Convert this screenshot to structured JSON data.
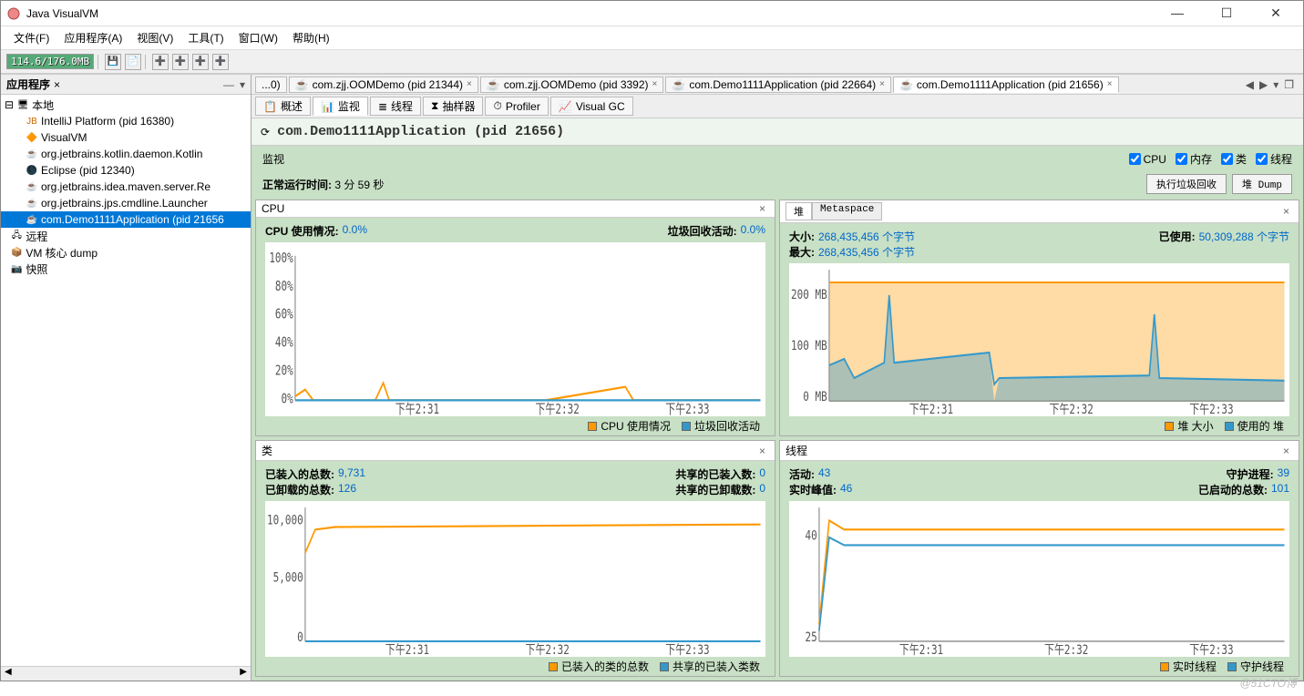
{
  "window": {
    "title": "Java VisualVM"
  },
  "menus": [
    "文件(F)",
    "应用程序(A)",
    "视图(V)",
    "工具(T)",
    "窗口(W)",
    "帮助(H)"
  ],
  "toolbar": {
    "mem": "114.6/176.0MB"
  },
  "sidebar": {
    "title": "应用程序",
    "nodes": {
      "local": "本地",
      "items": [
        "IntelliJ Platform (pid 16380)",
        "VisualVM",
        "org.jetbrains.kotlin.daemon.Kotlin",
        "Eclipse (pid 12340)",
        "org.jetbrains.idea.maven.server.Re",
        "org.jetbrains.jps.cmdline.Launcher",
        "com.Demo1111Application (pid 21656"
      ],
      "remote": "远程",
      "vmdump": "VM 核心 dump",
      "snapshot": "快照"
    }
  },
  "tabs": [
    "...0)",
    "com.zjj.OOMDemo (pid 21344)",
    "com.zjj.OOMDemo (pid 3392)",
    "com.Demo1111Application (pid 22664)",
    "com.Demo1111Application (pid 21656)"
  ],
  "subtabs": [
    "概述",
    "监视",
    "线程",
    "抽样器",
    "Profiler",
    "Visual GC"
  ],
  "app": {
    "name": "com.Demo1111Application (pid 21656)"
  },
  "monitor": {
    "label": "监视",
    "checks": [
      "CPU",
      "内存",
      "类",
      "线程"
    ],
    "buttons": {
      "gc": "执行垃圾回收",
      "dump": "堆 Dump"
    },
    "uptime_label": "正常运行时间:",
    "uptime_value": "3 分 59 秒"
  },
  "cpu": {
    "title": "CPU",
    "usage_label": "CPU 使用情况:",
    "usage_value": "0.0%",
    "gc_label": "垃圾回收活动:",
    "gc_value": "0.0%",
    "legend": [
      "CPU 使用情况",
      "垃圾回收活动"
    ],
    "xticks": [
      "下午2:31",
      "下午2:32",
      "下午2:33"
    ],
    "ylabels": [
      "0%",
      "20%",
      "40%",
      "60%",
      "80%",
      "100%"
    ]
  },
  "heap": {
    "tabs": [
      "堆",
      "Metaspace"
    ],
    "size_label": "大小:",
    "size_value": "268,435,456 个字节",
    "max_label": "最大:",
    "max_value": "268,435,456 个字节",
    "used_label": "已使用:",
    "used_value": "50,309,288 个字节",
    "legend": [
      "堆 大小",
      "使用的 堆"
    ],
    "xticks": [
      "下午2:31",
      "下午2:32",
      "下午2:33"
    ],
    "ylabels": [
      "0 MB",
      "100 MB",
      "200 MB"
    ]
  },
  "classes": {
    "title": "类",
    "loaded_label": "已装入的总数:",
    "loaded_value": "9,731",
    "unloaded_label": "已卸载的总数:",
    "unloaded_value": "126",
    "shared_loaded_label": "共享的已装入数:",
    "shared_loaded_value": "0",
    "shared_unloaded_label": "共享的已卸载数:",
    "shared_unloaded_value": "0",
    "legend": [
      "已装入的类的总数",
      "共享的已装入类数"
    ],
    "xticks": [
      "下午2:31",
      "下午2:32",
      "下午2:33"
    ],
    "ylabels": [
      "0",
      "5,000",
      "10,000"
    ]
  },
  "threads": {
    "title": "线程",
    "live_label": "活动:",
    "live_value": "43",
    "peak_label": "实时峰值:",
    "peak_value": "46",
    "daemon_label": "守护进程:",
    "daemon_value": "39",
    "started_label": "已启动的总数:",
    "started_value": "101",
    "legend": [
      "实时线程",
      "守护线程"
    ],
    "xticks": [
      "下午2:31",
      "下午2:32",
      "下午2:33"
    ],
    "ylabels": [
      "25",
      "40"
    ]
  },
  "chart_data": [
    {
      "type": "line",
      "title": "CPU",
      "x": [
        "2:31",
        "2:32",
        "2:33"
      ],
      "series": [
        {
          "name": "CPU 使用情况",
          "values": [
            3,
            0,
            8,
            0,
            0,
            0,
            5,
            0
          ]
        },
        {
          "name": "垃圾回收活动",
          "values": [
            0,
            0,
            0,
            0,
            0,
            0,
            0,
            0
          ]
        }
      ],
      "ylim": [
        0,
        100
      ]
    },
    {
      "type": "area",
      "title": "堆",
      "x": [
        "2:31",
        "2:32",
        "2:33"
      ],
      "series": [
        {
          "name": "堆 大小",
          "values": [
            256,
            256,
            256,
            256,
            256,
            256
          ]
        },
        {
          "name": "使用的 堆",
          "values": [
            60,
            75,
            220,
            90,
            85,
            60,
            50,
            150,
            50
          ]
        }
      ],
      "ylim": [
        0,
        260
      ],
      "unit": "MB"
    },
    {
      "type": "line",
      "title": "类",
      "x": [
        "2:31",
        "2:32",
        "2:33"
      ],
      "series": [
        {
          "name": "已装入的类的总数",
          "values": [
            7500,
            9500,
            9700,
            9731,
            9731,
            9731
          ]
        },
        {
          "name": "共享的已装入类数",
          "values": [
            0,
            0,
            0,
            0,
            0,
            0
          ]
        }
      ],
      "ylim": [
        0,
        10000
      ]
    },
    {
      "type": "line",
      "title": "线程",
      "x": [
        "2:31",
        "2:32",
        "2:33"
      ],
      "series": [
        {
          "name": "实时线程",
          "values": [
            28,
            44,
            43,
            43,
            43,
            43
          ]
        },
        {
          "name": "守护线程",
          "values": [
            25,
            40,
            39,
            39,
            39,
            39
          ]
        }
      ],
      "ylim": [
        25,
        46
      ]
    }
  ],
  "watermark": "@51CTO博"
}
